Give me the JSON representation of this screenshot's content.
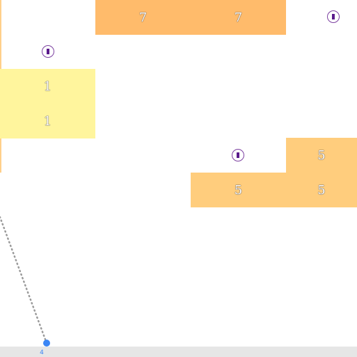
{
  "colors": {
    "brick_high": "#ffbb6b",
    "brick_mid": "#ffcd7d",
    "brick_low": "#fff59d",
    "bonus_ring": "#7b3fa0",
    "ball": "#3b86f5",
    "aim_line": "#9a9a9a",
    "floor": "#e6e6e6"
  },
  "bricks": [
    {
      "id": "r0c1",
      "value": "7",
      "tone": "orange-dark"
    },
    {
      "id": "r0c2",
      "value": "7",
      "tone": "orange-dark"
    },
    {
      "id": "r2c0",
      "value": "1",
      "tone": "yellow"
    },
    {
      "id": "r3c0",
      "value": "1",
      "tone": "yellow"
    },
    {
      "id": "r4c3",
      "value": "5",
      "tone": "orange-light"
    },
    {
      "id": "r5c2",
      "value": "5",
      "tone": "orange-light"
    },
    {
      "id": "r5c3",
      "value": "5",
      "tone": "orange-light"
    }
  ],
  "bonus_icon": "extra-ball-icon",
  "ball": {
    "count": "4"
  }
}
